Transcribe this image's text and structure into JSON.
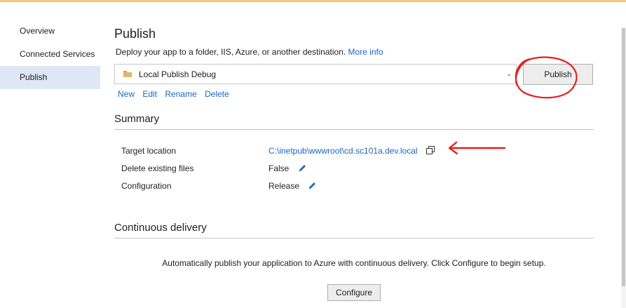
{
  "sidebar": {
    "items": [
      {
        "label": "Overview"
      },
      {
        "label": "Connected Services"
      },
      {
        "label": "Publish",
        "active": true
      }
    ]
  },
  "header": {
    "title": "Publish",
    "description": "Deploy your app to a folder, IIS, Azure, or another destination.",
    "more_info": "More info"
  },
  "profile": {
    "selected": "Local Publish Debug",
    "folder_icon": "folder-icon",
    "dropdown_icon": "chevron-down-icon"
  },
  "publish_button": "Publish",
  "profile_actions": {
    "new": "New",
    "edit": "Edit",
    "rename": "Rename",
    "delete": "Delete"
  },
  "summary": {
    "title": "Summary",
    "rows": [
      {
        "label": "Target location",
        "value": "C:\\inetpub\\wwwroot\\cd.sc101a.dev.local",
        "icon": "copy-icon"
      },
      {
        "label": "Delete existing files",
        "value": "False",
        "icon": "pencil-icon"
      },
      {
        "label": "Configuration",
        "value": "Release",
        "icon": "pencil-icon"
      }
    ]
  },
  "continuous_delivery": {
    "title": "Continuous delivery",
    "text": "Automatically publish your application to Azure with continuous delivery. Click Configure to begin setup.",
    "configure_button": "Configure"
  },
  "colors": {
    "link": "#1a66c2",
    "sidebar_active": "#dfe6f5",
    "annotation": "#e32020",
    "top_accent": "#f5c97a"
  }
}
